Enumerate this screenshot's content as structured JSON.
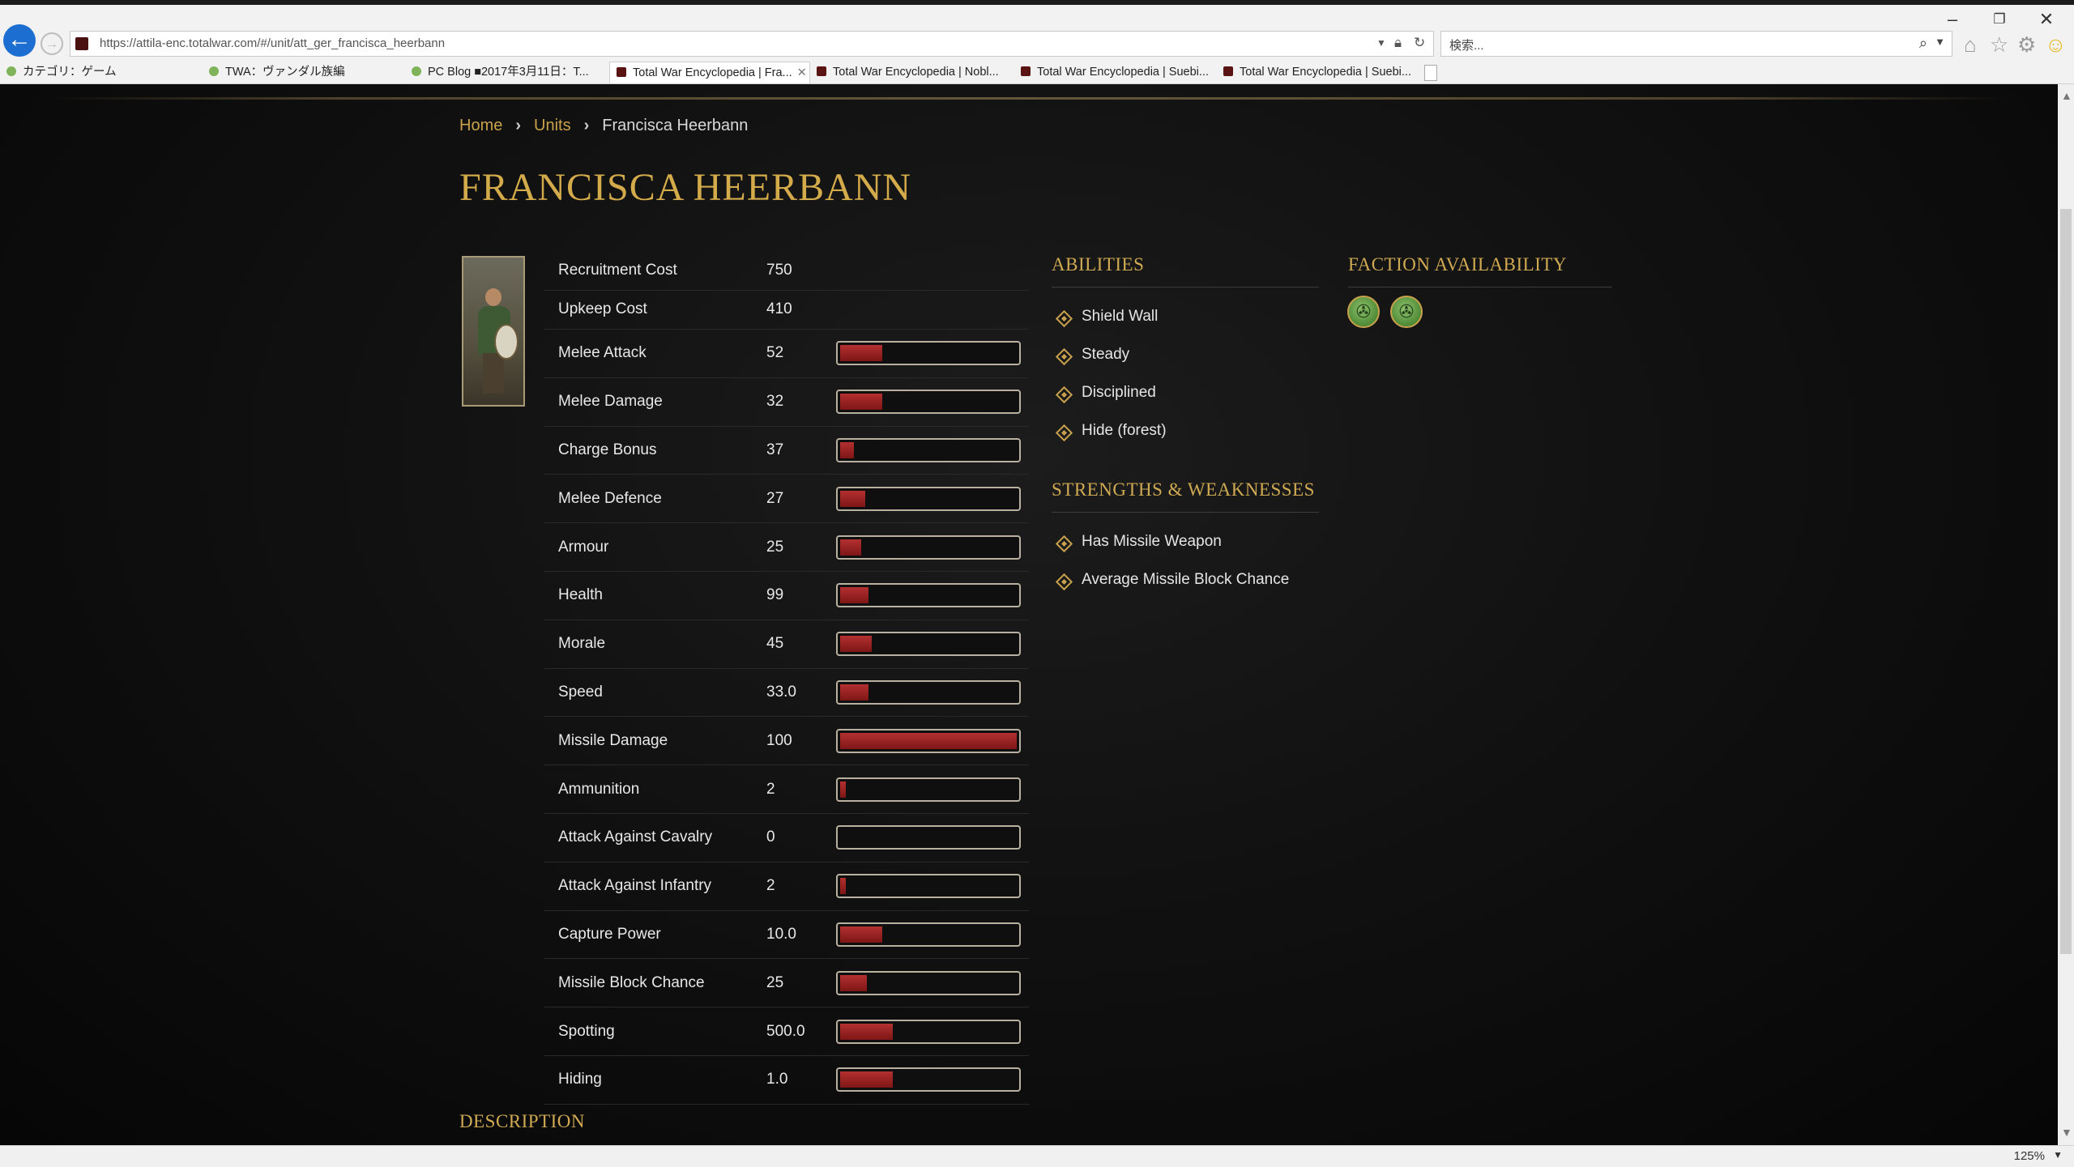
{
  "browser": {
    "url": "https://attila-enc.totalwar.com/#/unit/att_ger_francisca_heerbann",
    "search_placeholder": "検索...",
    "tabs": [
      {
        "label": "カテゴリ：ゲーム",
        "active": false
      },
      {
        "label": "TWA：ヴァンダル族編",
        "active": false
      },
      {
        "label": "PC Blog ■2017年3月11日：T...",
        "active": false
      },
      {
        "label": "Total War Encyclopedia | Fra...",
        "active": true
      },
      {
        "label": "Total War Encyclopedia | Nobl...",
        "active": false
      },
      {
        "label": "Total War Encyclopedia | Suebi...",
        "active": false
      },
      {
        "label": "Total War Encyclopedia | Suebi...",
        "active": false
      }
    ],
    "zoom": "125%"
  },
  "breadcrumb": {
    "home": "Home",
    "units": "Units",
    "current": "Francisca Heerbann"
  },
  "title": "FRANCISCA HEERBANN",
  "stats": [
    {
      "label": "Recruitment Cost",
      "value": "750"
    },
    {
      "label": "Upkeep Cost",
      "value": "410"
    },
    {
      "label": "Melee Attack",
      "value": "52",
      "fill": 0.24
    },
    {
      "label": "Melee Damage",
      "value": "32",
      "fill": 0.24
    },
    {
      "label": "Charge Bonus",
      "value": "37",
      "fill": 0.08
    },
    {
      "label": "Melee Defence",
      "value": "27",
      "fill": 0.14
    },
    {
      "label": "Armour",
      "value": "25",
      "fill": 0.12
    },
    {
      "label": "Health",
      "value": "99",
      "fill": 0.16
    },
    {
      "label": "Morale",
      "value": "45",
      "fill": 0.18
    },
    {
      "label": "Speed",
      "value": "33.0",
      "fill": 0.16
    },
    {
      "label": "Missile Damage",
      "value": "100",
      "fill": 1.0
    },
    {
      "label": "Ammunition",
      "value": "2",
      "fill": 0.03
    },
    {
      "label": "Attack Against Cavalry",
      "value": "0",
      "fill": 0.0
    },
    {
      "label": "Attack Against Infantry",
      "value": "2",
      "fill": 0.03
    },
    {
      "label": "Capture Power",
      "value": "10.0",
      "fill": 0.24
    },
    {
      "label": "Missile Block Chance",
      "value": "25",
      "fill": 0.15
    },
    {
      "label": "Spotting",
      "value": "500.0",
      "fill": 0.3
    },
    {
      "label": "Hiding",
      "value": "1.0",
      "fill": 0.3
    }
  ],
  "abilities": {
    "heading": "ABILITIES",
    "items": [
      "Shield Wall",
      "Steady",
      "Disciplined",
      "Hide (forest)"
    ]
  },
  "strengths": {
    "heading": "STRENGTHS & WEAKNESSES",
    "items": [
      "Has Missile Weapon",
      "Average Missile Block Chance"
    ]
  },
  "faction": {
    "heading": "FACTION AVAILABILITY",
    "icons": [
      "triskele-faction-icon",
      "triskele-faction-icon"
    ]
  },
  "description_heading": "DESCRIPTION",
  "colors": {
    "accent_gold": "#d4ab4a",
    "bar_red": "#b33030",
    "background": "#0b0b0b"
  }
}
